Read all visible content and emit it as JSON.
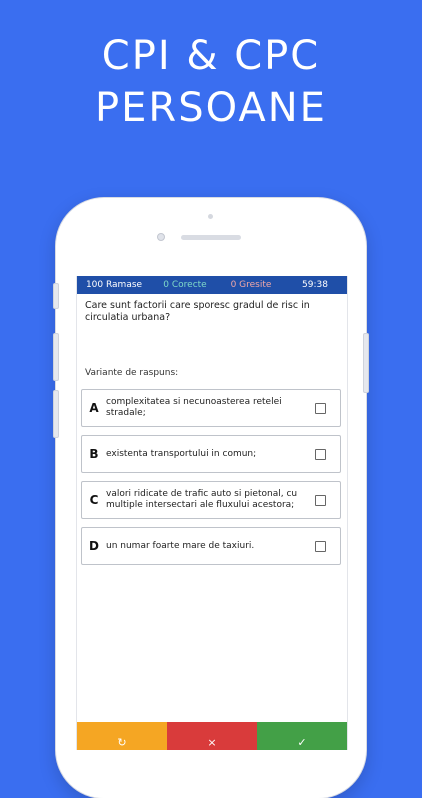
{
  "promo": {
    "line1": "CPI & CPC",
    "line2": "PERSOANE"
  },
  "status": {
    "remaining": "100 Ramase",
    "correct": "0 Corecte",
    "wrong": "0 Gresite",
    "timer": "59:38"
  },
  "question": {
    "text": "Care sunt factorii care sporesc gradul de risc in circulatia urbana?",
    "variants_label": "Variante de raspuns:"
  },
  "answers": [
    {
      "letter": "A",
      "text": "complexitatea si necunoasterea retelei stradale;"
    },
    {
      "letter": "B",
      "text": "existenta transportului in comun;"
    },
    {
      "letter": "C",
      "text": "valori ridicate de trafic auto si pietonal, cu multiple intersectari ale fluxului acestora;"
    },
    {
      "letter": "D",
      "text": "un numar foarte mare de taxiuri."
    }
  ],
  "actions": {
    "restart_icon": "↻",
    "close_icon": "×",
    "confirm_icon": "✓"
  },
  "colors": {
    "background": "#3a6ef0",
    "status_bar": "#1f4fa8",
    "restart": "#f5a623",
    "close": "#d93b3b",
    "confirm": "#43a047"
  }
}
